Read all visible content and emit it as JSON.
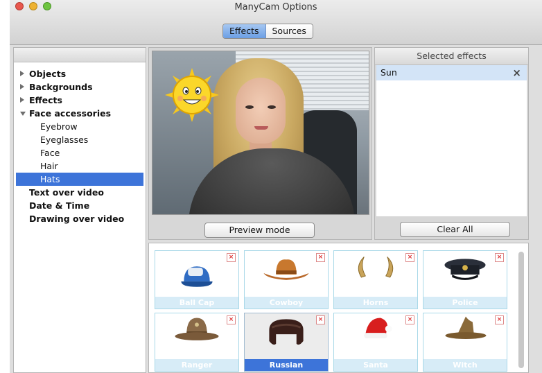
{
  "window": {
    "title": "ManyCam Options"
  },
  "tabs": [
    {
      "label": "Effects",
      "active": true
    },
    {
      "label": "Sources",
      "active": false
    }
  ],
  "tree": {
    "items": [
      {
        "label": "Objects",
        "level": 0,
        "state": "collapsed"
      },
      {
        "label": "Backgrounds",
        "level": 0,
        "state": "collapsed"
      },
      {
        "label": "Effects",
        "level": 0,
        "state": "collapsed"
      },
      {
        "label": "Face accessories",
        "level": 0,
        "state": "expanded"
      },
      {
        "label": "Eyebrow",
        "level": 1
      },
      {
        "label": "Eyeglasses",
        "level": 1
      },
      {
        "label": "Face",
        "level": 1
      },
      {
        "label": "Hair",
        "level": 1
      },
      {
        "label": "Hats",
        "level": 1,
        "selected": true
      },
      {
        "label": "Text over video",
        "level": 0
      },
      {
        "label": "Date & Time",
        "level": 0
      },
      {
        "label": "Drawing over video",
        "level": 0
      }
    ]
  },
  "preview": {
    "button_label": "Preview mode"
  },
  "selected_effects": {
    "header": "Selected effects",
    "items": [
      {
        "label": "Sun",
        "remove_icon": "×"
      }
    ],
    "clear_label": "Clear All"
  },
  "hats": [
    {
      "label": "Ball Cap",
      "icon": "ball-cap-icon"
    },
    {
      "label": "Cowboy",
      "icon": "cowboy-hat-icon"
    },
    {
      "label": "Horns",
      "icon": "horns-icon"
    },
    {
      "label": "Police",
      "icon": "police-cap-icon"
    },
    {
      "label": "Ranger",
      "icon": "ranger-hat-icon"
    },
    {
      "label": "Russian",
      "icon": "russian-hat-icon",
      "selected": true
    },
    {
      "label": "Santa",
      "icon": "santa-hat-icon"
    },
    {
      "label": "Witch",
      "icon": "witch-hat-icon"
    }
  ],
  "colors": {
    "selection": "#3d74d9",
    "tile_label_bg": "#d7ecf7",
    "selected_row_bg": "#d3e4f7"
  }
}
